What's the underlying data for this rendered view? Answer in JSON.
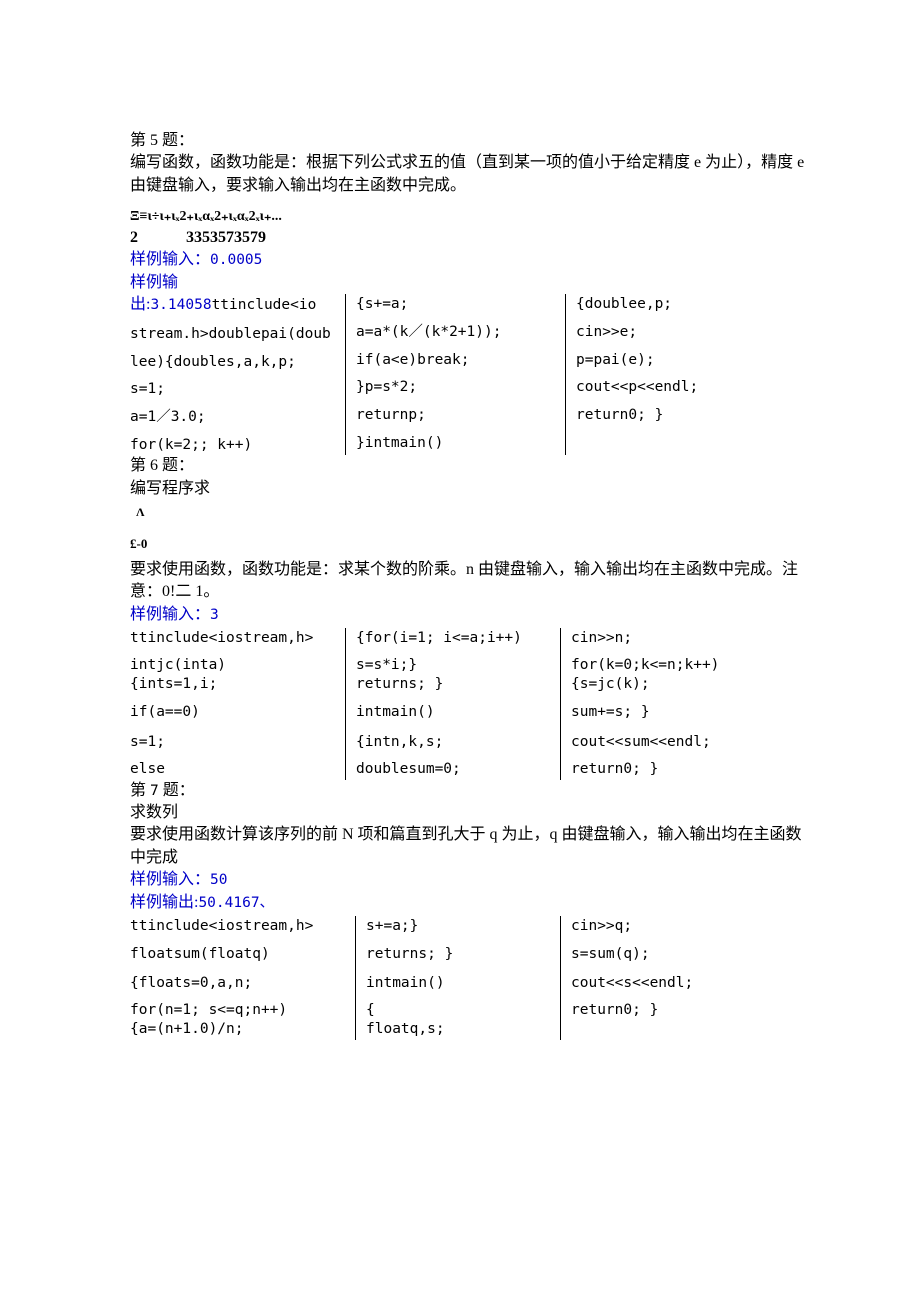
{
  "q5": {
    "heading": "第 5 题：",
    "desc": "编写函数，函数功能是：根据下列公式求五的值（直到某一项的值小于给定精度 e 为止），精度 e 由键盘输入，要求输入输出均在主函数中完成。",
    "formula1": "Ξ≡ι÷ι₊ιₓ2₊ιₓαₓ2₊ιₓαₓ2ₓι₊...",
    "formula2": "2   3353573579",
    "sample_in_label": "样例输入：",
    "sample_in_val": "0.0005",
    "sample_out_label": "样例输",
    "sample_out_label2": "出:",
    "sample_out_val": "3.14058",
    "code": {
      "c1": [
        "ttinclude<io",
        "stream.h>doublepai(doub",
        "lee){doubles,a,k,p;",
        "s=1;",
        "a=1／3.0;",
        "for(k=2;; k++)"
      ],
      "c2": [
        "{s+=a;",
        "a=a*(k／(k*2+1));",
        "if(a<e)break;",
        "}p=s*2;",
        "returnp;",
        "}intmain()"
      ],
      "c3": [
        "{doublee,p;",
        "cin>>e;",
        "p=pai(e);",
        "cout<<p<<endl;",
        "return0; }"
      ]
    }
  },
  "q6": {
    "heading": "第 6 题：",
    "line1": "编写程序求",
    "sym1": "Λ",
    "sym2": "£-0",
    "desc": "要求使用函数，函数功能是：求某个数的阶乘。n 由键盘输入，输入输出均在主函数中完成。注意：0!二 1。",
    "sample_in_label": "样例输入：",
    "sample_in_val": "3",
    "code": {
      "c1": [
        "ttinclude<iostream,h>",
        "intjc(inta)",
        "{ints=1,i;",
        "if(a==0)",
        "s=1;",
        "else"
      ],
      "c2": [
        "{for(i=1; i<=a;i++)",
        "s=s*i;}",
        "returns; }",
        "intmain()",
        "{intn,k,s;",
        "doublesum=0;"
      ],
      "c3": [
        "cin>>n;",
        "for(k=0;k<=n;k++)",
        "{s=jc(k);",
        "sum+=s; }",
        "cout<<sum<<endl;",
        "return0; }"
      ]
    }
  },
  "q7": {
    "heading_pre": "第 ",
    "heading_num": "7",
    "heading_post": " 题：",
    "line1": "求数列",
    "desc": "要求使用函数计算该序列的前 N 项和篇直到孔大于 q 为止，q 由键盘输入，输入输出均在主函数中完成",
    "sample_in_label": "样例输入：",
    "sample_in_val": "50",
    "sample_out_label": "样例输出:",
    "sample_out_val": "50.4167、",
    "code": {
      "c1": [
        "ttinclude<iostream,h>",
        "floatsum(floatq)",
        "{floats=0,a,n;",
        "for(n=1; s<=q;n++)",
        "{a=(n+1.0)/n;"
      ],
      "c2": [
        "s+=a;}",
        "returns; }",
        "intmain()",
        "{",
        "floatq,s;"
      ],
      "c3": [
        "cin>>q;",
        "s=sum(q);",
        "cout<<s<<endl;",
        "return0; }"
      ]
    }
  }
}
